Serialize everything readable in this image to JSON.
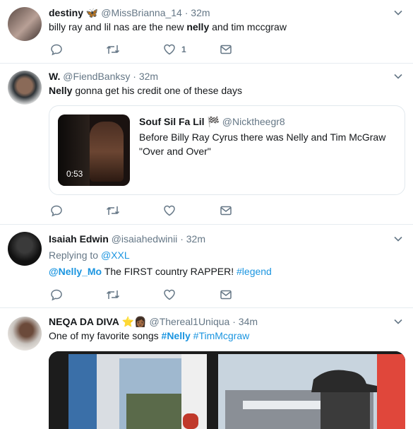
{
  "tweets": [
    {
      "name": "destiny",
      "name_emoji": "🦋",
      "handle": "@MissBrianna_14",
      "time": "32m",
      "text_parts": [
        "billy ray and lil nas are the new ",
        "nelly",
        " and tim mccgraw"
      ],
      "like_count": "1"
    },
    {
      "name": "W.",
      "handle": "@FiendBanksy",
      "time": "32m",
      "text_parts": [
        "Nelly",
        " gonna get his credit one of these days"
      ],
      "quote": {
        "name": "Souf Sil Fa Lil",
        "name_emoji": "🏁",
        "handle": "@Nicktheegr8",
        "text": "Before Billy Ray Cyrus there was Nelly and Tim McGraw \"Over and Over\"",
        "duration": "0:53"
      }
    },
    {
      "name": "Isaiah Edwin",
      "handle": "@isaiahedwinii",
      "time": "32m",
      "replying_label": "Replying to ",
      "replying_handle": "@XXL",
      "text_parts": [
        "@Nelly_Mo",
        " The FIRST country RAPPER! ",
        "#legend"
      ]
    },
    {
      "name": "NEQA DA DIVA",
      "name_emoji": "⭐👩🏾",
      "handle": "@Thereal1Uniqua",
      "time": "34m",
      "text_parts": [
        "One of my favorite songs ",
        "#Nelly",
        " ",
        "#TimMcgraw"
      ]
    }
  ],
  "separator": "·",
  "colors": {
    "link": "#1b95e0",
    "muted": "#657786",
    "border": "#e6ecf0"
  }
}
